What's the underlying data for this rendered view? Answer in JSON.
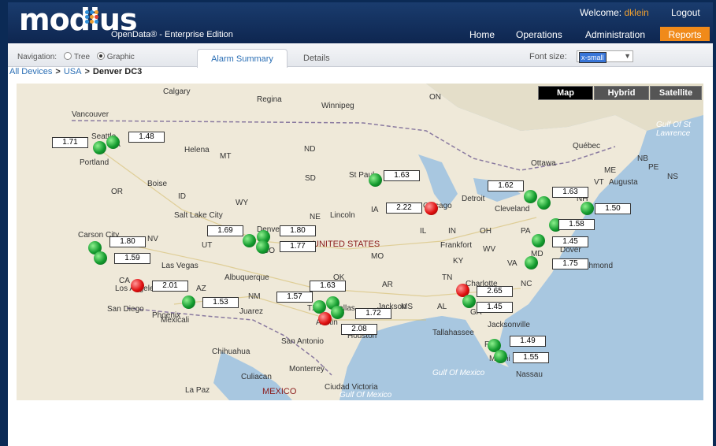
{
  "header": {
    "logo": "modius",
    "subtitle": "OpenData® - Enterprise Edition",
    "welcome_prefix": "Welcome:",
    "username": "dklein",
    "logout": "Logout",
    "nav": [
      "Home",
      "Operations",
      "Administration",
      "Reports"
    ],
    "accent": "#f08a1a",
    "logo_dots": [
      "#2f8fd8",
      "#2f8fd8",
      "#f0a030",
      "#2f8fd8",
      "#f0a030",
      "#e04030",
      "#2f8fd8",
      "#f0a030",
      "#2f8fd8"
    ]
  },
  "toolbar": {
    "nav_label": "Navigation:",
    "tree": "Tree",
    "graphic": "Graphic",
    "tabs": [
      "Alarm Summary",
      "Details"
    ],
    "font_size_label": "Font size:",
    "font_size_value": "x-small"
  },
  "breadcrumb": [
    "All Devices",
    "USA",
    "Denver DC3"
  ],
  "map": {
    "types": [
      "Map",
      "Hybrid",
      "Satellite"
    ],
    "labels": {
      "big": [
        "UNITED STATES",
        "MEXICO"
      ],
      "water": [
        "Gulf Of St Lawrence",
        "Gulf Of Mexico",
        "Gulf Of Mexico"
      ],
      "places": [
        "Calgary",
        "Regina",
        "Winnipeg",
        "ON",
        "Vancouver",
        "Seattle",
        "WA",
        "Helena",
        "MT",
        "ND",
        "Québec",
        "NB",
        "PE",
        "NS",
        "Portland",
        "OR",
        "Boise",
        "ID",
        "SD",
        "St Paul",
        "Ottawa",
        "ME",
        "VT",
        "Augusta",
        "Detroit",
        "Cleveland",
        "NH",
        "WY",
        "Salt Lake City",
        "NE",
        "Lincoln",
        "IA",
        "Chicago",
        "IL",
        "IN",
        "OH",
        "PA",
        "Carson City",
        "NV",
        "Denver",
        "UT",
        "CO",
        "Frankfort",
        "WV",
        "MO",
        "KY",
        "VA",
        "Dover",
        "MD",
        "Richmond",
        "Las Vegas",
        "CA",
        "Los Angeles",
        "AZ",
        "Albuquerque",
        "NM",
        "OK",
        "TN",
        "Charlotte",
        "NC",
        "San Diego",
        "Phoenix",
        "Mexicali",
        "Juarez",
        "TX",
        "Dallas",
        "AR",
        "Jackson",
        "MS",
        "AL",
        "GA",
        "Tallahassee",
        "Jacksonville",
        "FL",
        "Miami",
        "Nassau",
        "Austin",
        "San Antonio",
        "Houston",
        "Chihuahua",
        "Monterrey",
        "Culiacan",
        "Ciudad Victoria",
        "La Paz"
      ]
    },
    "sites": [
      {
        "value": "1.71",
        "status": "green"
      },
      {
        "value": "1.48",
        "status": "green"
      },
      {
        "value": "1.80",
        "status": "green"
      },
      {
        "value": "1.59",
        "status": "green"
      },
      {
        "value": "2.01",
        "status": "red"
      },
      {
        "value": "1.53",
        "status": "green"
      },
      {
        "value": "1.69",
        "status": "green"
      },
      {
        "value": "1.80",
        "status": "green"
      },
      {
        "value": "1.77",
        "status": "green"
      },
      {
        "value": "1.63",
        "status": "green"
      },
      {
        "value": "2.22",
        "status": "red"
      },
      {
        "value": "1.63",
        "status": "green"
      },
      {
        "value": "1.57",
        "status": "green"
      },
      {
        "value": "1.72",
        "status": "green"
      },
      {
        "value": "2.08",
        "status": "red"
      },
      {
        "value": "1.62",
        "status": "green"
      },
      {
        "value": "1.63",
        "status": "green"
      },
      {
        "value": "1.50",
        "status": "green"
      },
      {
        "value": "1.58",
        "status": "green"
      },
      {
        "value": "1.45",
        "status": "green"
      },
      {
        "value": "1.75",
        "status": "green"
      },
      {
        "value": "2.65",
        "status": "red"
      },
      {
        "value": "1.45",
        "status": "green"
      },
      {
        "value": "1.49",
        "status": "green"
      },
      {
        "value": "1.55",
        "status": "green"
      }
    ]
  }
}
